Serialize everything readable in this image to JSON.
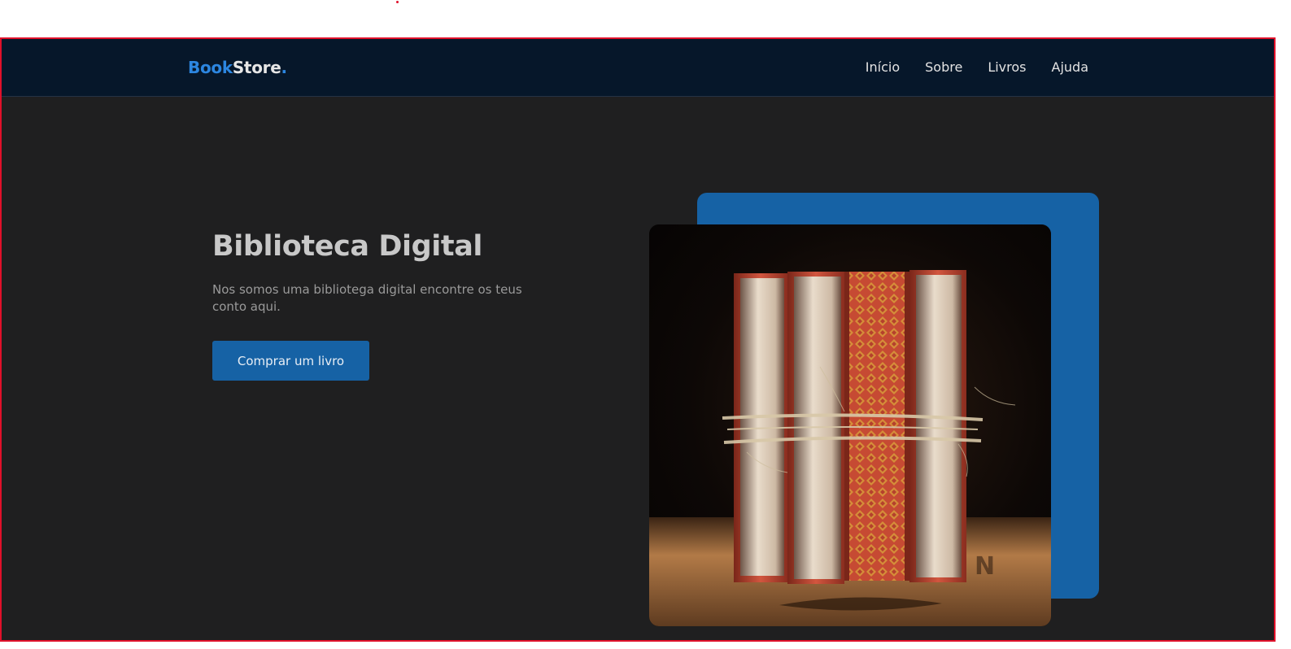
{
  "navbar": {
    "logo": {
      "part_a": "Book",
      "part_b": "Store",
      "part_c": "."
    },
    "links": [
      "Início",
      "Sobre",
      "Livros",
      "Ajuda"
    ]
  },
  "hero": {
    "title": "Biblioteca Digital",
    "text": "Nos somos uma bibliotega digital encontre os teus conto aqui.",
    "button": "Comprar um livro"
  },
  "image": {
    "subject": "books-tied-with-twine-photo"
  },
  "colors": {
    "navbar_bg": "#06172a",
    "page_bg": "#1f1f20",
    "accent": "#1662a5",
    "logo_blue": "#2c86e0",
    "frame_border": "#e0102a"
  }
}
